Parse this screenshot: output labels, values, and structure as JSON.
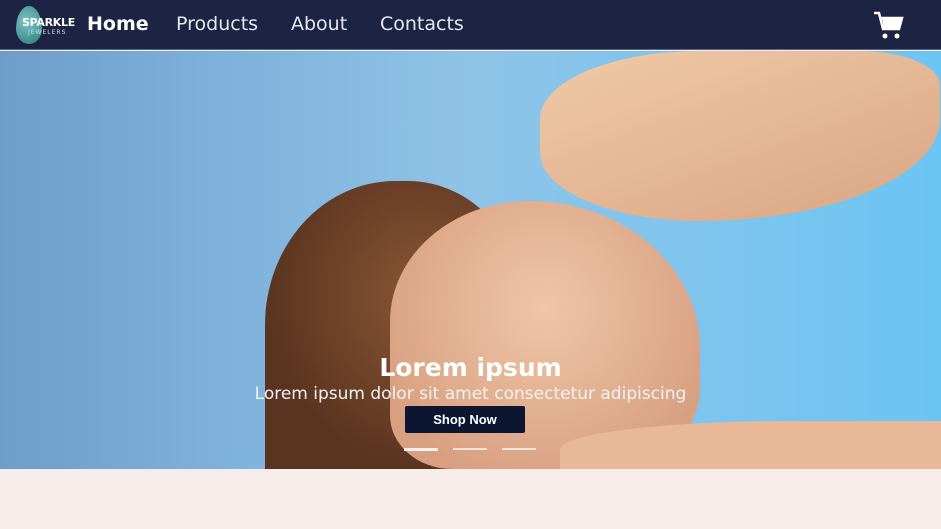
{
  "nav": {
    "logo_text": "SPARKLE",
    "logo_sub": "JEWELERS",
    "items": [
      "Home",
      "Products",
      "About",
      "Contacts"
    ],
    "active": "Home"
  },
  "hero": {
    "title": "Lorem ipsum",
    "subtitle": "Lorem ipsum dolor sit amet consectetur adipiscing",
    "button": "Shop Now",
    "slides": 3,
    "active_slide": 1
  }
}
